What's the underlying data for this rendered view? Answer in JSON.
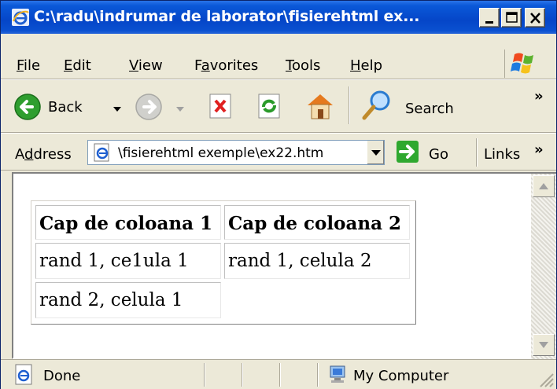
{
  "window": {
    "title": "C:\\radu\\indrumar de laborator\\fisierehtml ex..."
  },
  "menu": {
    "items": [
      {
        "label": "File",
        "mnemonic": "F",
        "rest": "ile"
      },
      {
        "label": "Edit",
        "mnemonic": "E",
        "rest": "dit"
      },
      {
        "label": "View",
        "mnemonic": "V",
        "rest": "iew"
      },
      {
        "label": "Favorites",
        "pre": "F",
        "mnemonic": "a",
        "rest": "vorites"
      },
      {
        "label": "Tools",
        "mnemonic": "T",
        "rest": "ools"
      },
      {
        "label": "Help",
        "mnemonic": "H",
        "rest": "elp"
      }
    ]
  },
  "toolbar": {
    "back_label": "Back",
    "search_label": "Search",
    "overflow": "»"
  },
  "address": {
    "label_pre": "A",
    "label_mnemonic": "d",
    "label_rest": "dress",
    "value": "\\fisierehtml exemple\\ex22.htm",
    "go_label": "Go",
    "links_label": "Links",
    "links_overflow": "»"
  },
  "page": {
    "table": {
      "headers": [
        "Cap de coloana 1",
        "Cap de coloana 2"
      ],
      "rows": [
        [
          "rand 1, ce1ula 1",
          "rand 1, celula 2"
        ],
        [
          "rand 2, celula 1"
        ]
      ]
    }
  },
  "status": {
    "text": "Done",
    "zone": "My Computer"
  },
  "colors": {
    "title_bar": "#0a4fd2",
    "chrome": "#ece9d8",
    "go_green": "#2fa82f"
  }
}
